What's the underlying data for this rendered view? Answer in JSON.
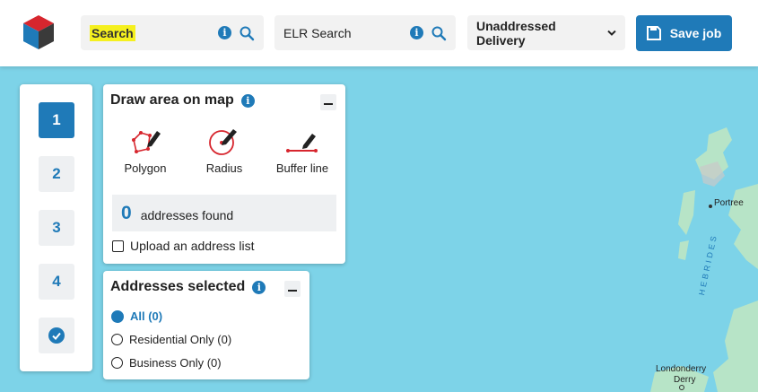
{
  "header": {
    "search": {
      "label": "Search"
    },
    "elr_search": {
      "label": "ELR Search"
    },
    "delivery_select": {
      "value": "Unaddressed Delivery"
    },
    "save_button": {
      "label": "Save job"
    }
  },
  "steps": [
    "1",
    "2",
    "3",
    "4"
  ],
  "draw_panel": {
    "title": "Draw area on map",
    "tools": [
      {
        "label": "Polygon",
        "icon": "polygon-draw-icon"
      },
      {
        "label": "Radius",
        "icon": "radius-draw-icon"
      },
      {
        "label": "Buffer line",
        "icon": "buffer-line-icon"
      }
    ],
    "found_count": "0",
    "found_text": "addresses found",
    "upload_label": "Upload an address list"
  },
  "addresses_panel": {
    "title": "Addresses selected",
    "options": [
      "All (0)",
      "Residential Only (0)",
      "Business Only (0)"
    ]
  },
  "map": {
    "labels": {
      "portree": "Portree",
      "hebrides": "HEBRIDES",
      "londonderry": "Londonderry",
      "derry": "Derry"
    }
  },
  "colors": {
    "primary": "#1f7ab8",
    "highlight": "#f5f01e",
    "sea": "#7dd3e8",
    "land": "#b7e4c7"
  }
}
